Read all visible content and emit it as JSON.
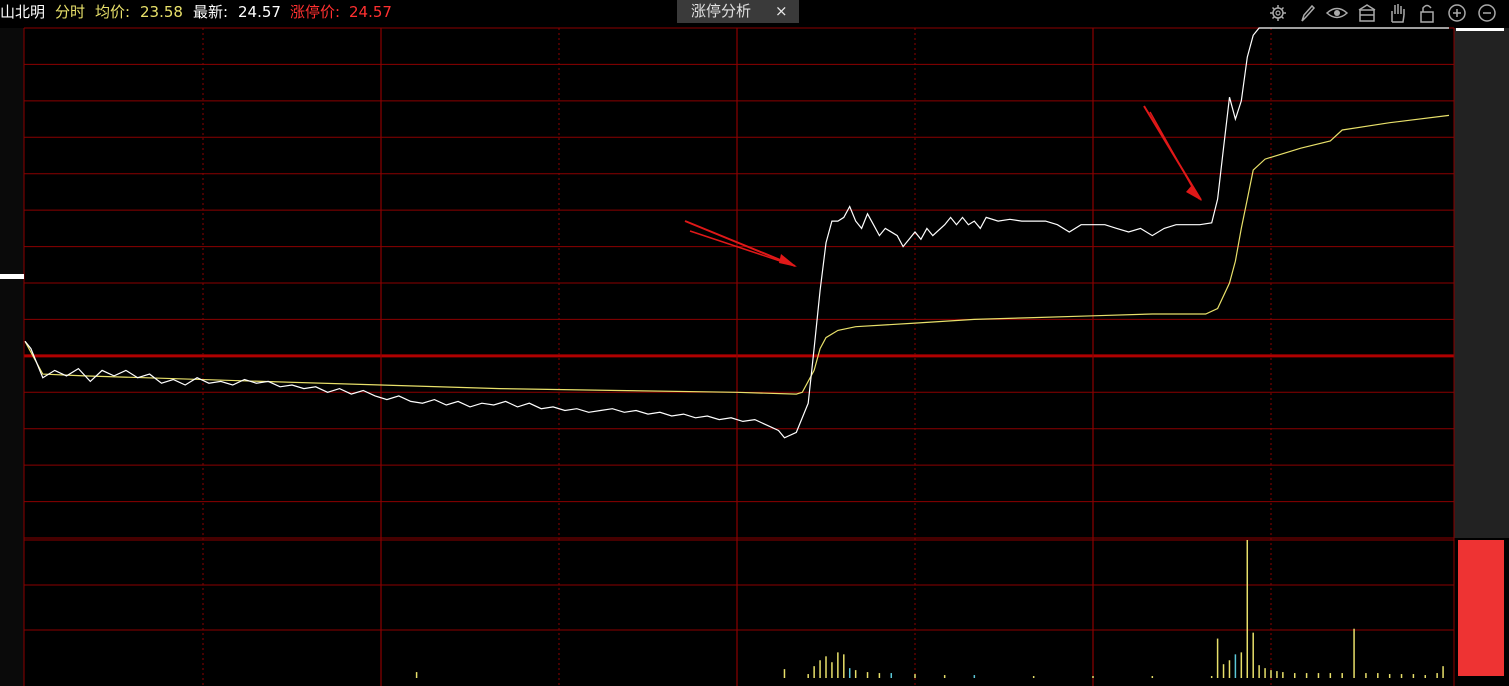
{
  "header": {
    "stock_name": "山北明",
    "mode_label": "分时",
    "avg_label": "均价:",
    "avg_value": "23.58",
    "latest_label": "最新:",
    "latest_value": "24.57",
    "limit_label": "涨停价:",
    "limit_value": "24.57"
  },
  "tab": {
    "label": "涨停分析",
    "close_icon": "×"
  },
  "toolbar": {
    "icons": [
      "gear-icon",
      "pen-icon",
      "eye-icon",
      "box-icon",
      "hand-icon",
      "lock-icon",
      "zoom-in-icon",
      "zoom-out-icon"
    ]
  },
  "colors": {
    "background": "#000000",
    "grid": "#8b0000",
    "price_line": "#ffffff",
    "avg_line": "#e8e06a",
    "arrow": "#e01818",
    "volume_up": "#e8e06a",
    "volume_down": "#5bc8d8",
    "stock_name": "#ffffff",
    "label_yellow": "#e8e06a",
    "limit_red": "#ff3030"
  },
  "chart_data": {
    "type": "line",
    "x_range": [
      0,
      240
    ],
    "y_range": [
      -5,
      9
    ],
    "series": [
      {
        "key": "price",
        "values": [
          [
            0,
            0.4
          ],
          [
            1,
            0.2
          ],
          [
            3,
            -0.6
          ],
          [
            5,
            -0.4
          ],
          [
            7,
            -0.55
          ],
          [
            9,
            -0.35
          ],
          [
            11,
            -0.7
          ],
          [
            13,
            -0.4
          ],
          [
            15,
            -0.55
          ],
          [
            17,
            -0.4
          ],
          [
            19,
            -0.6
          ],
          [
            21,
            -0.5
          ],
          [
            23,
            -0.75
          ],
          [
            25,
            -0.65
          ],
          [
            27,
            -0.8
          ],
          [
            29,
            -0.6
          ],
          [
            31,
            -0.75
          ],
          [
            33,
            -0.7
          ],
          [
            35,
            -0.8
          ],
          [
            37,
            -0.65
          ],
          [
            39,
            -0.75
          ],
          [
            41,
            -0.7
          ],
          [
            43,
            -0.85
          ],
          [
            45,
            -0.8
          ],
          [
            47,
            -0.9
          ],
          [
            49,
            -0.85
          ],
          [
            51,
            -1.0
          ],
          [
            53,
            -0.9
          ],
          [
            55,
            -1.05
          ],
          [
            57,
            -0.95
          ],
          [
            59,
            -1.1
          ],
          [
            61,
            -1.2
          ],
          [
            63,
            -1.1
          ],
          [
            65,
            -1.25
          ],
          [
            67,
            -1.3
          ],
          [
            69,
            -1.2
          ],
          [
            71,
            -1.35
          ],
          [
            73,
            -1.25
          ],
          [
            75,
            -1.4
          ],
          [
            77,
            -1.3
          ],
          [
            79,
            -1.35
          ],
          [
            81,
            -1.25
          ],
          [
            83,
            -1.4
          ],
          [
            85,
            -1.3
          ],
          [
            87,
            -1.45
          ],
          [
            89,
            -1.4
          ],
          [
            91,
            -1.5
          ],
          [
            93,
            -1.45
          ],
          [
            95,
            -1.55
          ],
          [
            97,
            -1.5
          ],
          [
            99,
            -1.45
          ],
          [
            101,
            -1.55
          ],
          [
            103,
            -1.5
          ],
          [
            105,
            -1.6
          ],
          [
            107,
            -1.55
          ],
          [
            109,
            -1.65
          ],
          [
            111,
            -1.6
          ],
          [
            113,
            -1.7
          ],
          [
            115,
            -1.65
          ],
          [
            117,
            -1.75
          ],
          [
            119,
            -1.7
          ],
          [
            121,
            -1.8
          ],
          [
            123,
            -1.75
          ],
          [
            125,
            -1.9
          ],
          [
            127,
            -2.05
          ],
          [
            128,
            -2.25
          ],
          [
            130,
            -2.1
          ],
          [
            132,
            -1.3
          ],
          [
            133,
            0.2
          ],
          [
            134,
            1.8
          ],
          [
            135,
            3.1
          ],
          [
            136,
            3.7
          ],
          [
            137,
            3.7
          ],
          [
            138,
            3.8
          ],
          [
            139,
            4.1
          ],
          [
            140,
            3.7
          ],
          [
            141,
            3.5
          ],
          [
            142,
            3.9
          ],
          [
            143,
            3.6
          ],
          [
            144,
            3.3
          ],
          [
            145,
            3.5
          ],
          [
            147,
            3.3
          ],
          [
            148,
            3.0
          ],
          [
            149,
            3.2
          ],
          [
            150,
            3.4
          ],
          [
            151,
            3.2
          ],
          [
            152,
            3.5
          ],
          [
            153,
            3.3
          ],
          [
            155,
            3.6
          ],
          [
            156,
            3.8
          ],
          [
            157,
            3.6
          ],
          [
            158,
            3.8
          ],
          [
            159,
            3.6
          ],
          [
            160,
            3.7
          ],
          [
            161,
            3.5
          ],
          [
            162,
            3.8
          ],
          [
            164,
            3.7
          ],
          [
            166,
            3.75
          ],
          [
            168,
            3.7
          ],
          [
            170,
            3.7
          ],
          [
            172,
            3.7
          ],
          [
            174,
            3.6
          ],
          [
            176,
            3.4
          ],
          [
            178,
            3.6
          ],
          [
            180,
            3.6
          ],
          [
            182,
            3.6
          ],
          [
            184,
            3.5
          ],
          [
            186,
            3.4
          ],
          [
            188,
            3.5
          ],
          [
            190,
            3.3
          ],
          [
            192,
            3.5
          ],
          [
            194,
            3.6
          ],
          [
            196,
            3.6
          ],
          [
            198,
            3.6
          ],
          [
            200,
            3.65
          ],
          [
            201,
            4.3
          ],
          [
            202,
            5.7
          ],
          [
            203,
            7.1
          ],
          [
            204,
            6.5
          ],
          [
            205,
            7.0
          ],
          [
            206,
            8.2
          ],
          [
            207,
            8.8
          ],
          [
            208,
            9.0
          ],
          [
            240,
            9.0
          ]
        ]
      },
      {
        "key": "avg",
        "values": [
          [
            0,
            0.4
          ],
          [
            1,
            0.1
          ],
          [
            3,
            -0.5
          ],
          [
            10,
            -0.55
          ],
          [
            20,
            -0.6
          ],
          [
            40,
            -0.7
          ],
          [
            60,
            -0.8
          ],
          [
            80,
            -0.9
          ],
          [
            100,
            -0.95
          ],
          [
            120,
            -1.0
          ],
          [
            130,
            -1.05
          ],
          [
            131,
            -1.0
          ],
          [
            133,
            -0.4
          ],
          [
            134,
            0.2
          ],
          [
            135,
            0.5
          ],
          [
            137,
            0.7
          ],
          [
            140,
            0.8
          ],
          [
            150,
            0.9
          ],
          [
            160,
            1.0
          ],
          [
            170,
            1.05
          ],
          [
            180,
            1.1
          ],
          [
            190,
            1.15
          ],
          [
            199,
            1.15
          ],
          [
            201,
            1.3
          ],
          [
            203,
            2.0
          ],
          [
            204,
            2.6
          ],
          [
            205,
            3.5
          ],
          [
            206,
            4.3
          ],
          [
            207,
            5.1
          ],
          [
            209,
            5.4
          ],
          [
            215,
            5.7
          ],
          [
            220,
            5.9
          ],
          [
            222,
            6.2
          ],
          [
            230,
            6.4
          ],
          [
            240,
            6.6
          ]
        ]
      }
    ],
    "volume": [
      {
        "x": 66,
        "v": 6,
        "c": "up"
      },
      {
        "x": 128,
        "v": 9,
        "c": "up"
      },
      {
        "x": 132,
        "v": 4,
        "c": "up"
      },
      {
        "x": 133,
        "v": 12,
        "c": "up"
      },
      {
        "x": 134,
        "v": 18,
        "c": "up"
      },
      {
        "x": 135,
        "v": 22,
        "c": "up"
      },
      {
        "x": 136,
        "v": 16,
        "c": "up"
      },
      {
        "x": 137,
        "v": 26,
        "c": "up"
      },
      {
        "x": 138,
        "v": 24,
        "c": "up"
      },
      {
        "x": 139,
        "v": 10,
        "c": "down"
      },
      {
        "x": 140,
        "v": 8,
        "c": "up"
      },
      {
        "x": 142,
        "v": 6,
        "c": "up"
      },
      {
        "x": 144,
        "v": 5,
        "c": "up"
      },
      {
        "x": 146,
        "v": 5,
        "c": "down"
      },
      {
        "x": 150,
        "v": 4,
        "c": "up"
      },
      {
        "x": 155,
        "v": 3,
        "c": "up"
      },
      {
        "x": 160,
        "v": 3,
        "c": "down"
      },
      {
        "x": 170,
        "v": 2,
        "c": "up"
      },
      {
        "x": 180,
        "v": 2,
        "c": "up"
      },
      {
        "x": 190,
        "v": 2,
        "c": "up"
      },
      {
        "x": 200,
        "v": 2,
        "c": "up"
      },
      {
        "x": 201,
        "v": 40,
        "c": "up"
      },
      {
        "x": 202,
        "v": 14,
        "c": "up"
      },
      {
        "x": 203,
        "v": 18,
        "c": "up"
      },
      {
        "x": 204,
        "v": 24,
        "c": "down"
      },
      {
        "x": 205,
        "v": 26,
        "c": "up"
      },
      {
        "x": 206,
        "v": 140,
        "c": "up"
      },
      {
        "x": 207,
        "v": 46,
        "c": "up"
      },
      {
        "x": 208,
        "v": 13,
        "c": "up"
      },
      {
        "x": 209,
        "v": 10,
        "c": "up"
      },
      {
        "x": 210,
        "v": 8,
        "c": "up"
      },
      {
        "x": 211,
        "v": 7,
        "c": "up"
      },
      {
        "x": 212,
        "v": 6,
        "c": "up"
      },
      {
        "x": 214,
        "v": 5,
        "c": "up"
      },
      {
        "x": 216,
        "v": 5,
        "c": "up"
      },
      {
        "x": 218,
        "v": 5,
        "c": "up"
      },
      {
        "x": 220,
        "v": 5,
        "c": "up"
      },
      {
        "x": 222,
        "v": 5,
        "c": "up"
      },
      {
        "x": 224,
        "v": 50,
        "c": "up"
      },
      {
        "x": 226,
        "v": 5,
        "c": "up"
      },
      {
        "x": 228,
        "v": 5,
        "c": "up"
      },
      {
        "x": 230,
        "v": 4,
        "c": "up"
      },
      {
        "x": 232,
        "v": 4,
        "c": "up"
      },
      {
        "x": 234,
        "v": 4,
        "c": "up"
      },
      {
        "x": 236,
        "v": 3,
        "c": "up"
      },
      {
        "x": 238,
        "v": 5,
        "c": "up"
      },
      {
        "x": 239,
        "v": 12,
        "c": "up"
      }
    ],
    "volume_max": 140
  }
}
